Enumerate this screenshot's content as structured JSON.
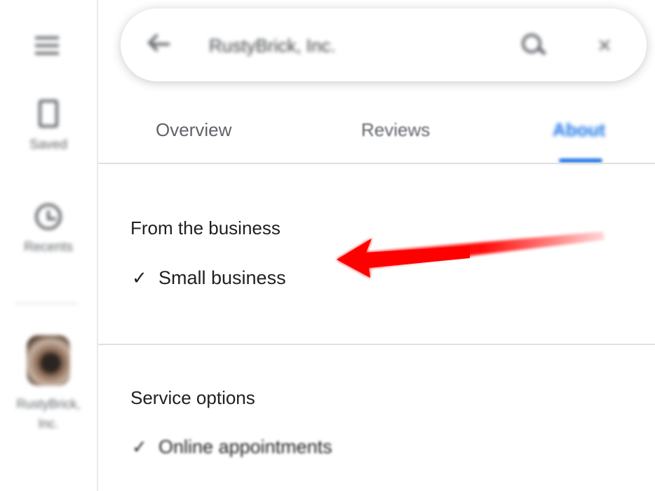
{
  "rail": {
    "saved_label": "Saved",
    "recents_label": "Recents",
    "business_label_line1": "RustyBrick,",
    "business_label_line2": "Inc."
  },
  "search": {
    "value": "RustyBrick, Inc."
  },
  "tabs": [
    {
      "label": "Overview"
    },
    {
      "label": "Reviews"
    },
    {
      "label": "About"
    }
  ],
  "sections": {
    "from_business": {
      "heading": "From the business",
      "items": [
        {
          "label": "Small business"
        }
      ]
    },
    "service_options": {
      "heading": "Service options",
      "items": [
        {
          "label": "Online appointments"
        }
      ]
    }
  },
  "icons": {
    "menu": "menu-icon",
    "saved": "bookmark-icon",
    "recents": "history-icon",
    "back": "arrow-back-icon",
    "search": "search-icon",
    "close": "close-icon",
    "check": "check-icon"
  },
  "colors": {
    "accent": "#1a73e8",
    "annotation_arrow": "#ff0000",
    "text_primary": "#202124",
    "text_secondary": "#5f6368"
  }
}
